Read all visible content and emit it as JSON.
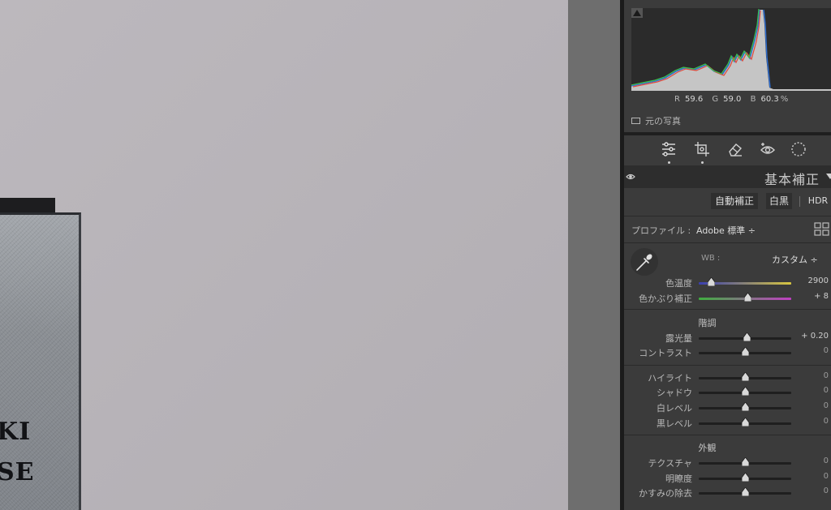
{
  "canvas": {
    "book_text_lines": [
      "KI",
      "SE"
    ]
  },
  "histogram": {
    "readout": {
      "r_label": "R",
      "r_value": "59.6",
      "g_label": "G",
      "g_value": "59.0",
      "b_label": "B",
      "b_value": "60.3",
      "unit": "%"
    },
    "original_photo_label": "元の写真"
  },
  "tools": [
    "edit-sliders-icon",
    "crop-icon",
    "eraser-icon",
    "redeye-icon",
    "mask-icon"
  ],
  "basic": {
    "title": "基本補正",
    "auto_label": "自動補正",
    "bw_label": "白黒",
    "hdr_label": "HDR",
    "profile_label": "プロファイル :",
    "profile_value": "Adobe 標準 ÷",
    "wb_label": "WB :",
    "wb_value": "カスタム ÷",
    "sections": {
      "tone": "階調",
      "presence": "外観"
    },
    "sliders": [
      {
        "label": "色温度",
        "value": "2900",
        "position": 0.13
      },
      {
        "label": "色かぶり補正",
        "value": "+ 8",
        "position": 0.53
      },
      {
        "label": "露光量",
        "value": "+ 0.20",
        "position": 0.52
      },
      {
        "label": "コントラスト",
        "value": "0",
        "position": 0.5
      },
      {
        "label": "ハイライト",
        "value": "0",
        "position": 0.5
      },
      {
        "label": "シャドウ",
        "value": "0",
        "position": 0.5
      },
      {
        "label": "白レベル",
        "value": "0",
        "position": 0.5
      },
      {
        "label": "黒レベル",
        "value": "0",
        "position": 0.5
      },
      {
        "label": "テクスチャ",
        "value": "0",
        "position": 0.5
      },
      {
        "label": "明瞭度",
        "value": "0",
        "position": 0.5
      },
      {
        "label": "かすみの除去",
        "value": "0",
        "position": 0.5
      }
    ]
  },
  "colors": {
    "panel_bg": "#3b3b3b",
    "header_bg": "#2d2d2d",
    "temp_track_start": "#3a3fb0",
    "temp_track_end": "#d7c640",
    "tint_track_start": "#3fae3f",
    "tint_track_end": "#c03fc3"
  }
}
